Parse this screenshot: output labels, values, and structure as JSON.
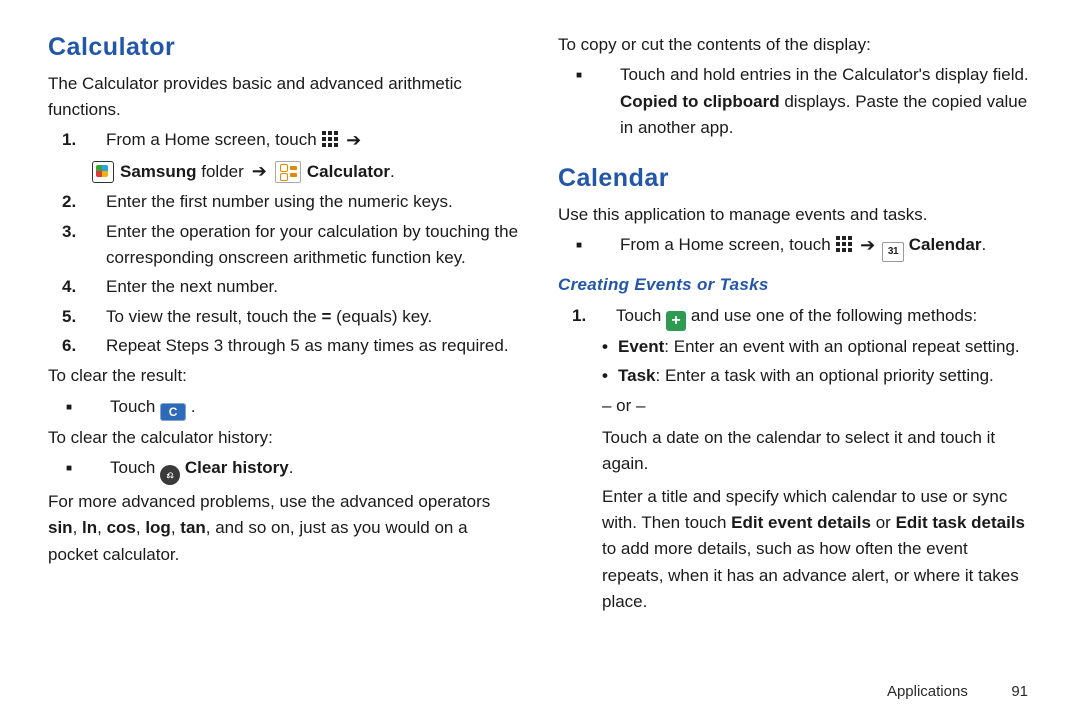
{
  "footer": {
    "label": "Applications",
    "page_number": "91"
  },
  "left": {
    "title": "Calculator",
    "intro": "The Calculator provides basic and advanced arithmetic functions.",
    "steps": {
      "s1_a": "From a Home screen, touch ",
      "s1_line2_a": "Samsung",
      "s1_line2_b": " folder ",
      "s1_line2_c": "Calculator",
      "s2": "Enter the first number using the numeric keys.",
      "s3": "Enter the operation for your calculation by touching the corresponding onscreen arithmetic function key.",
      "s4": "Enter the next number.",
      "s5_a": "To view the result, touch the ",
      "s5_b": "=",
      "s5_c": " (equals) key.",
      "s6": "Repeat Steps 3 through 5 as many times as required."
    },
    "clear_result_intro": "To clear the result:",
    "clear_result_touch": "Touch ",
    "clear_result_end": " .",
    "clear_history_intro": "To clear the calculator history:",
    "clear_history_touch": "Touch ",
    "clear_history_label": "Clear history",
    "clear_history_end": ".",
    "advanced_a": "For more advanced problems, use the advanced operators ",
    "advanced_b": "sin",
    "advanced_c": ", ",
    "advanced_d": "ln",
    "advanced_e": ", ",
    "advanced_f": "cos",
    "advanced_g": ", ",
    "advanced_h": "log",
    "advanced_i": ", ",
    "advanced_j": "tan",
    "advanced_k": ", and so on, just as you would on a pocket calculator.",
    "c_glyph": "C",
    "clear_glyph": "⎌",
    "num1": "1.",
    "num2": "2.",
    "num3": "3.",
    "num4": "4.",
    "num5": "5.",
    "num6": "6."
  },
  "right": {
    "copy_intro": "To copy or cut the contents of the display:",
    "copy_a": "Touch and hold entries in the Calculator's display field. ",
    "copy_b": "Copied to clipboard",
    "copy_c": " displays. Paste the copied value in another app.",
    "cal_title": "Calendar",
    "cal_intro": "Use this application to manage events and tasks.",
    "cal_from_a": "From a Home screen, touch ",
    "cal_from_b": "Calendar",
    "cal_from_end": ".",
    "cal_glyph": "31",
    "sub_title": "Creating Events or Tasks",
    "c1_a": "Touch ",
    "c1_b": " and use one of the following methods:",
    "plus_glyph": "+",
    "ev_label": "Event",
    "ev_text": ": Enter an event with an optional repeat setting.",
    "task_label": "Task",
    "task_text": ": Enter a task with an optional priority setting.",
    "or_text": "– or –",
    "touch_date": "Touch a date on the calendar to select it and touch it again.",
    "para2_a": "Enter a title and specify which calendar to use or sync with. Then touch ",
    "para2_b": "Edit event details",
    "para2_c": " or ",
    "para2_d": "Edit task details",
    "para2_e": " to add more details, such as how often the event repeats, when it has an advance alert, or where it takes place.",
    "num1": "1."
  },
  "sq_marker": "■"
}
